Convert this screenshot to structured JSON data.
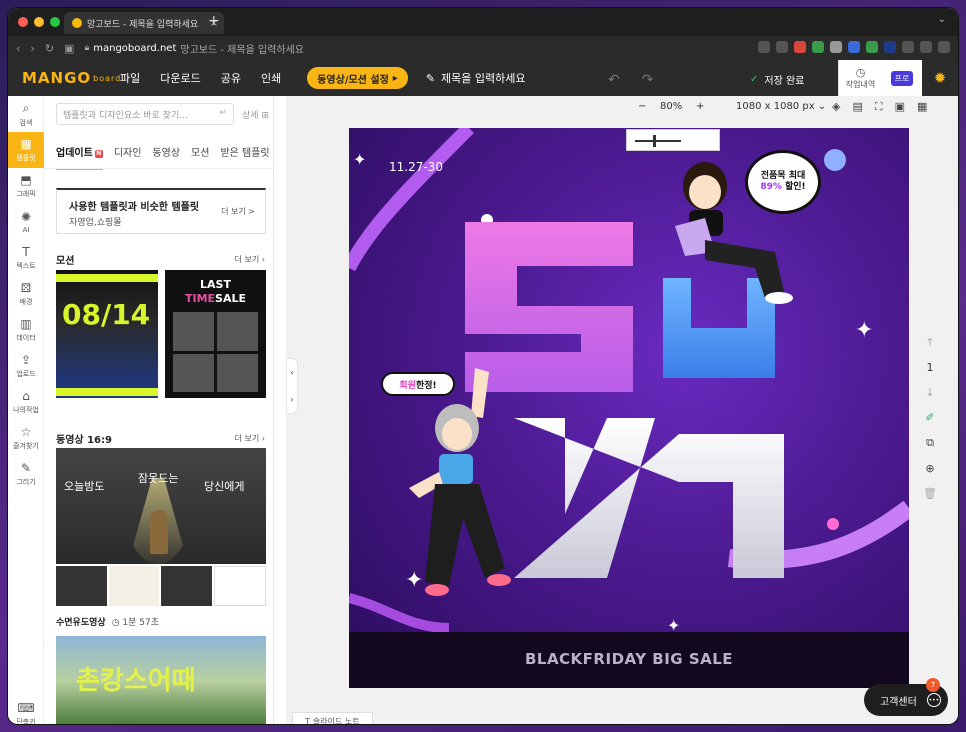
{
  "browser": {
    "tab_title": "망고보드 - 제목을 입력하세요",
    "url_host": "mangoboard.net",
    "url_rest": "망고보드 - 제목을 입력하세요"
  },
  "app": {
    "logo": "MANGO",
    "logo_sub": "board",
    "menu": [
      "파일",
      "다운로드",
      "공유",
      "인쇄"
    ],
    "video_button": "동영상/모션 설정",
    "title_placeholder": "제목을 입력하세요",
    "save_status": "저장 완료",
    "history_label": "작업내역",
    "pro_label": "프로"
  },
  "rail": {
    "items": [
      {
        "icon": "search-icon",
        "glyph": "⌕",
        "label": "검색"
      },
      {
        "icon": "template-icon",
        "glyph": "▦",
        "label": "템플릿"
      },
      {
        "icon": "graphic-icon",
        "glyph": "⬒",
        "label": "그래픽"
      },
      {
        "icon": "ai-icon",
        "glyph": "✺",
        "label": "AI"
      },
      {
        "icon": "text-icon",
        "glyph": "T",
        "label": "텍스트"
      },
      {
        "icon": "background-icon",
        "glyph": "⚄",
        "label": "배경"
      },
      {
        "icon": "data-icon",
        "glyph": "▥",
        "label": "데이터"
      },
      {
        "icon": "upload-icon",
        "glyph": "⇪",
        "label": "업로드"
      },
      {
        "icon": "my-work-icon",
        "glyph": "⌂",
        "label": "나의작업"
      },
      {
        "icon": "favorites-icon",
        "glyph": "☆",
        "label": "즐겨찾기"
      },
      {
        "icon": "draw-icon",
        "glyph": "✎",
        "label": "그리기"
      }
    ],
    "shortcut_label": "단축키"
  },
  "panel": {
    "search_placeholder": "템플릿과 디자인요소 바로 찾기...",
    "detail_link": "상세",
    "tabs": [
      "업데이트",
      "디자인",
      "동영상",
      "모션",
      "받은 템플릿"
    ],
    "new_badge": "N",
    "similar_title": "사용한 템플릿과 비슷한 템플릿",
    "similar_sub": "자영업,쇼핑몰",
    "similar_more": "더 보기 >",
    "motion_section": "모션",
    "motion_more": "더 보기",
    "motion_thumb1_text": "08/14",
    "motion_thumb2_line1": "LAST",
    "motion_thumb2_time": "TIME",
    "motion_thumb2_sale": "SALE",
    "video_section": "동영상 16:9",
    "video_more": "더 보기",
    "video_thumb_text": [
      "오늘밤도",
      "잠못드는",
      "당신에게"
    ],
    "sleep_video_label": "수면유도영상",
    "sleep_video_duration": "1분 57초",
    "video_thumb2_text": "촌캉스어때"
  },
  "workspace": {
    "zoom_value": "80%",
    "canvas_size": "1080 x 1080 px",
    "page_number": "1",
    "slide_note": "슬라이드 노트",
    "support_label": "고객센터",
    "support_badge": "7"
  },
  "canvas_art": {
    "date": "11.27-30",
    "bubble1_line1": "전품목 최대",
    "bubble1_pct": "89%",
    "bubble1_line2": "할인!",
    "bubble2_pink": "회원",
    "bubble2_rest": "한정!",
    "footer": "BLACKFRIDAY BIG SALE"
  },
  "colors": {
    "brand": "#f9b514",
    "header_bg": "#2b2b2b",
    "canvas_purple": "#4b1a8f"
  }
}
